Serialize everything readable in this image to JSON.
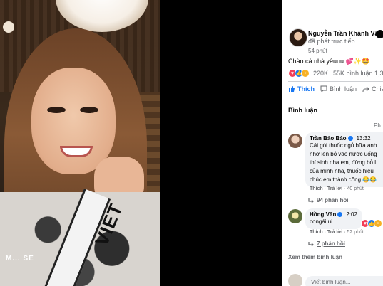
{
  "video": {
    "sash_text": "VIET",
    "logo_text": "M... SE"
  },
  "post": {
    "author": "Nguyễn Trần Khánh Vân",
    "activity": " đã phát trực tiếp.",
    "time": "54 phút",
    "text": "Chào cả nhà yêuuu 💕✨🤩",
    "reaction_count": "220K",
    "stats": "55K bình luận 1,3",
    "actions": {
      "like": "Thích",
      "comment": "Bình luận",
      "share": "Chia"
    }
  },
  "comments_section": {
    "title": "Bình luận",
    "filter": "Ph",
    "see_more": "Xem thêm bình luận",
    "write_placeholder": "Viết bình luận..."
  },
  "comments": [
    {
      "name": "Trần Bảo Bảo",
      "time": "13:32",
      "lines": [
        "Cái gói thuốc ngủ bữa anh",
        "nhớ lén bỏ vào nước uống",
        "thí sinh nha em, đừng bỏ l",
        "của mình nha, thuốc hiệu",
        "chúc em thành công 😂😂"
      ],
      "like": "Thích",
      "reply": "Trả lời",
      "age": "40 phút",
      "replies": "94 phản hồi"
    },
    {
      "name": "Hồng Vân",
      "time": "2:02",
      "lines": [
        "congái ui"
      ],
      "like": "Thích",
      "reply": "Trả lời",
      "age": "52 phút",
      "replies": "7 phản hồi"
    }
  ],
  "colors": {
    "accent": "#1877f2",
    "text": "#050505",
    "secondary": "#65676b",
    "bubble": "#f0f2f5"
  }
}
